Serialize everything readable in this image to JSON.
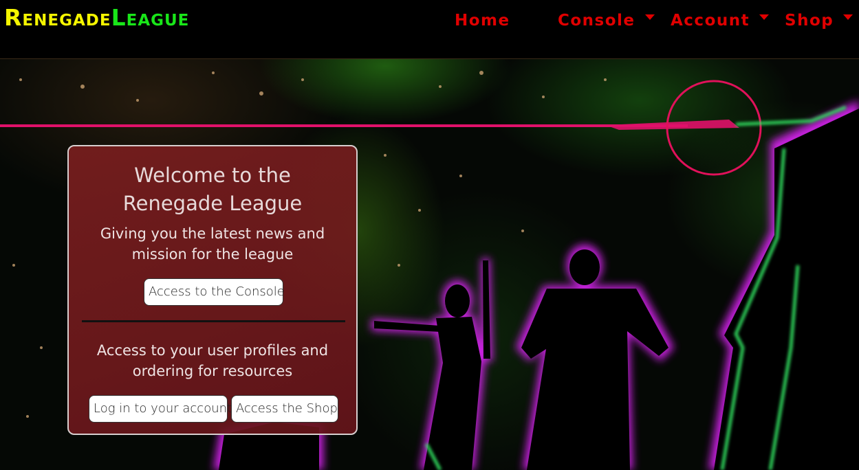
{
  "brand": {
    "part1": "Renegade",
    "part2": "League",
    "color1": "#f5f500",
    "color2": "#19e619"
  },
  "nav": {
    "color": "#e00000",
    "items": [
      {
        "label": "Home",
        "dropdown": false
      },
      {
        "label": "Console",
        "dropdown": true
      },
      {
        "label": "Account",
        "dropdown": true
      },
      {
        "label": "Shop",
        "dropdown": true
      }
    ]
  },
  "welcome": {
    "title_line1": "Welcome to the",
    "title_line2": "Renegade League",
    "subtitle_line1": "Giving you the latest news and",
    "subtitle_line2": "mission for the league",
    "console_button": "Access to the Console",
    "account_text_line1": "Access to your user profiles and",
    "account_text_line2": "ordering for resources",
    "login_button": "Log in to your account",
    "shop_button": "Access the Shop"
  },
  "colors": {
    "accent_pink": "#e0116a",
    "glow_magenta": "#d020e8",
    "glow_green": "#30e060"
  }
}
